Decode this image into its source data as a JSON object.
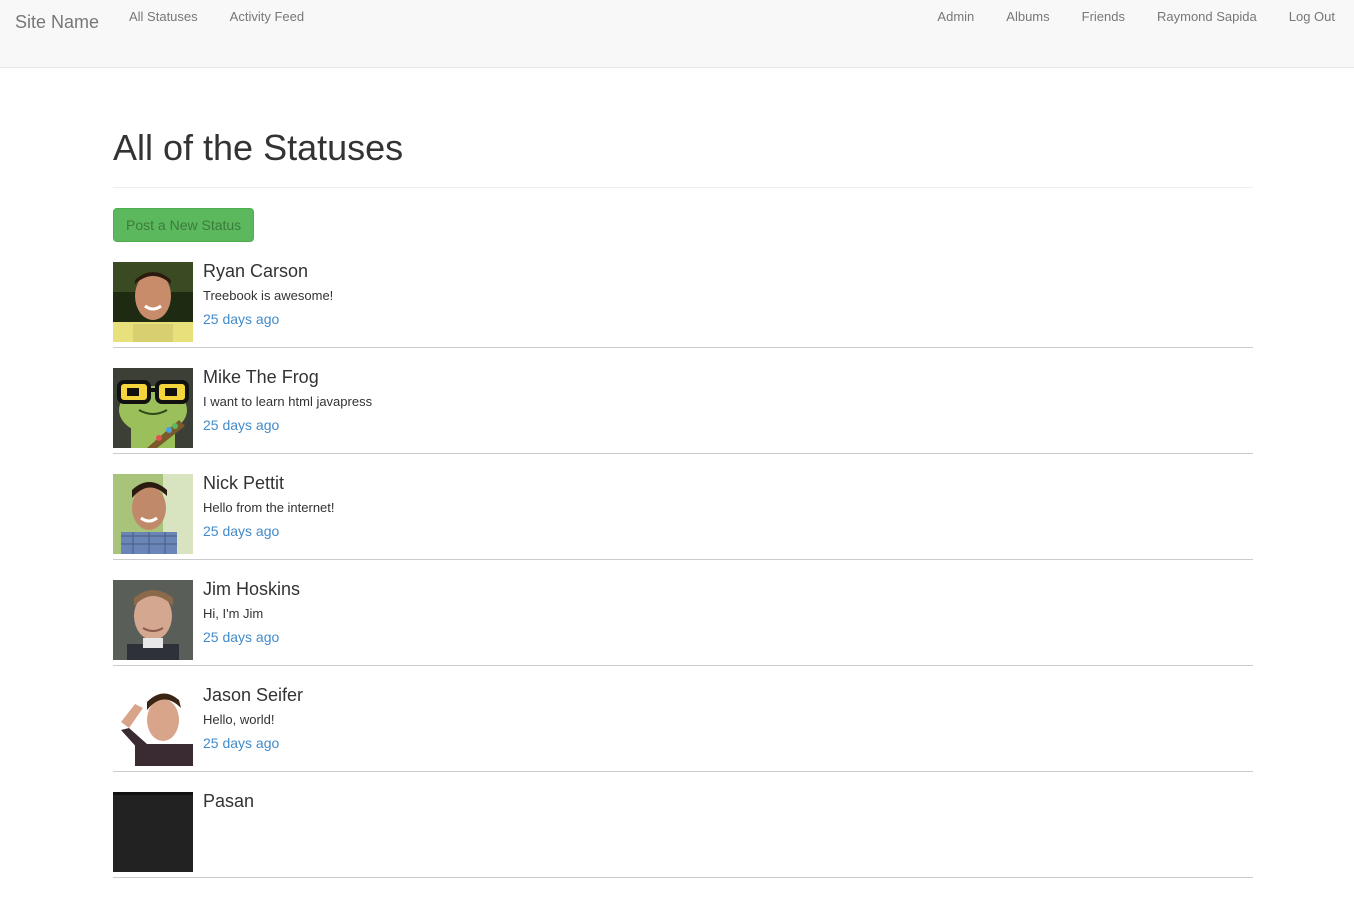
{
  "nav": {
    "brand": "Site Name",
    "left_links": [
      {
        "label": "All Statuses"
      },
      {
        "label": "Activity Feed"
      }
    ],
    "right_links": [
      {
        "label": "Admin"
      },
      {
        "label": "Albums"
      },
      {
        "label": "Friends"
      },
      {
        "label": "Raymond Sapida"
      },
      {
        "label": "Log Out"
      }
    ]
  },
  "page": {
    "title": "All of the Statuses",
    "post_button_label": "Post a New Status"
  },
  "colors": {
    "accent_green": "#5cb85c",
    "link_blue": "#428bca",
    "navbar_bg": "#f8f8f8"
  },
  "statuses": [
    {
      "name": "Ryan Carson",
      "text": "Treebook is awesome!",
      "time": "25 days ago"
    },
    {
      "name": "Mike The Frog",
      "text": "I want to learn html javapress",
      "time": "25 days ago"
    },
    {
      "name": "Nick Pettit",
      "text": "Hello from the internet!",
      "time": "25 days ago"
    },
    {
      "name": "Jim Hoskins",
      "text": "Hi, I'm Jim",
      "time": "25 days ago"
    },
    {
      "name": "Jason Seifer",
      "text": "Hello, world!",
      "time": "25 days ago"
    },
    {
      "name": "Pasan",
      "text": "",
      "time": ""
    }
  ]
}
